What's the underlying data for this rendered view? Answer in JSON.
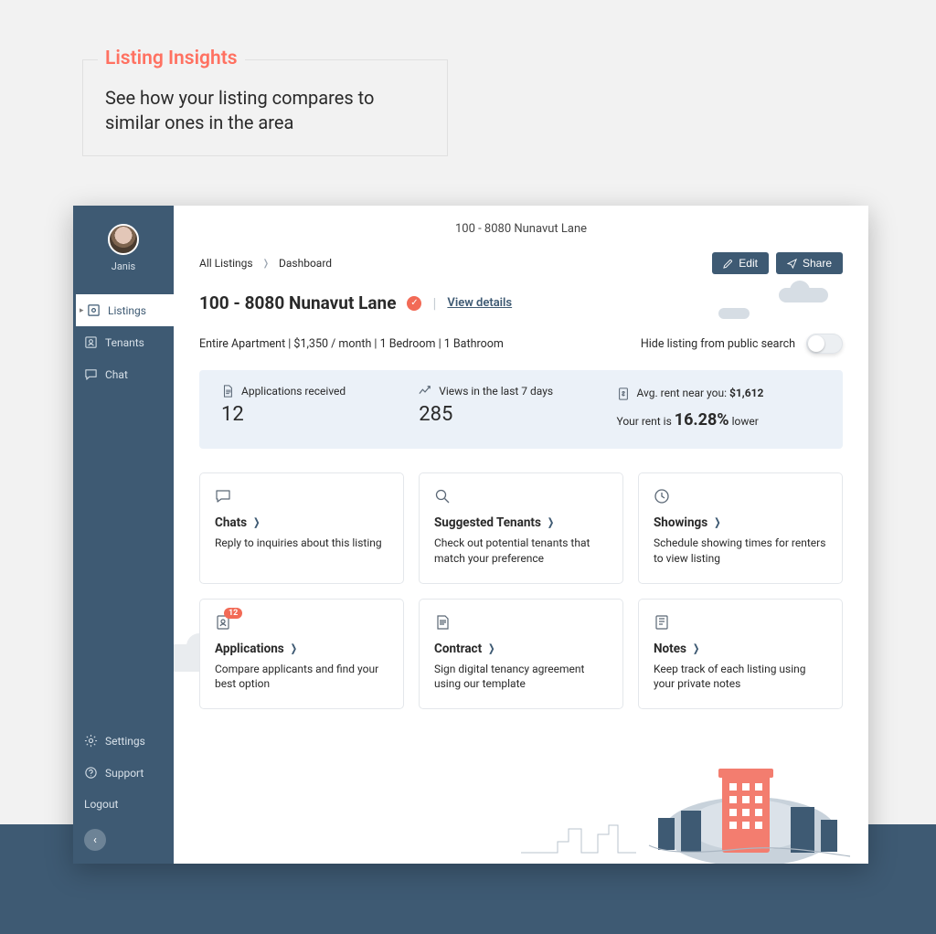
{
  "promo": {
    "title": "Listing Insights",
    "subtitle": "See how your listing compares to similar ones in the area"
  },
  "sidebar": {
    "user": "Janis",
    "nav": [
      {
        "label": "Listings",
        "active": true
      },
      {
        "label": "Tenants"
      },
      {
        "label": "Chat"
      }
    ],
    "bottom": [
      {
        "label": "Settings"
      },
      {
        "label": "Support"
      },
      {
        "label": "Logout"
      }
    ]
  },
  "header": {
    "window_title": "100 - 8080 Nunavut Lane",
    "breadcrumb": [
      "All Listings",
      "Dashboard"
    ],
    "buttons": {
      "edit": "Edit",
      "share": "Share"
    }
  },
  "listing": {
    "title": "100 - 8080 Nunavut Lane",
    "view_details": "View details",
    "subline": "Entire Apartment | $1,350 / month | 1 Bedroom | 1 Bathroom",
    "hide_toggle_label": "Hide listing from public search"
  },
  "stats": {
    "apps_label": "Applications received",
    "apps_value": "12",
    "views_label": "Views in the last 7 days",
    "views_value": "285",
    "avg_label_prefix": "Avg. rent near you: ",
    "avg_value": "$1,612",
    "rent_prefix": "Your rent is ",
    "rent_pct": "16.28%",
    "rent_suffix": " lower"
  },
  "cards": [
    {
      "title": "Chats",
      "desc": "Reply to inquiries about this listing"
    },
    {
      "title": "Suggested Tenants",
      "desc": "Check out potential tenants that match your preference"
    },
    {
      "title": "Showings",
      "desc": "Schedule showing times for renters to view listing"
    },
    {
      "title": "Applications",
      "desc": "Compare applicants and find your best option",
      "badge": "12"
    },
    {
      "title": "Contract",
      "desc": "Sign digital tenancy agreement using our template"
    },
    {
      "title": "Notes",
      "desc": "Keep track of each listing using your private notes"
    }
  ]
}
